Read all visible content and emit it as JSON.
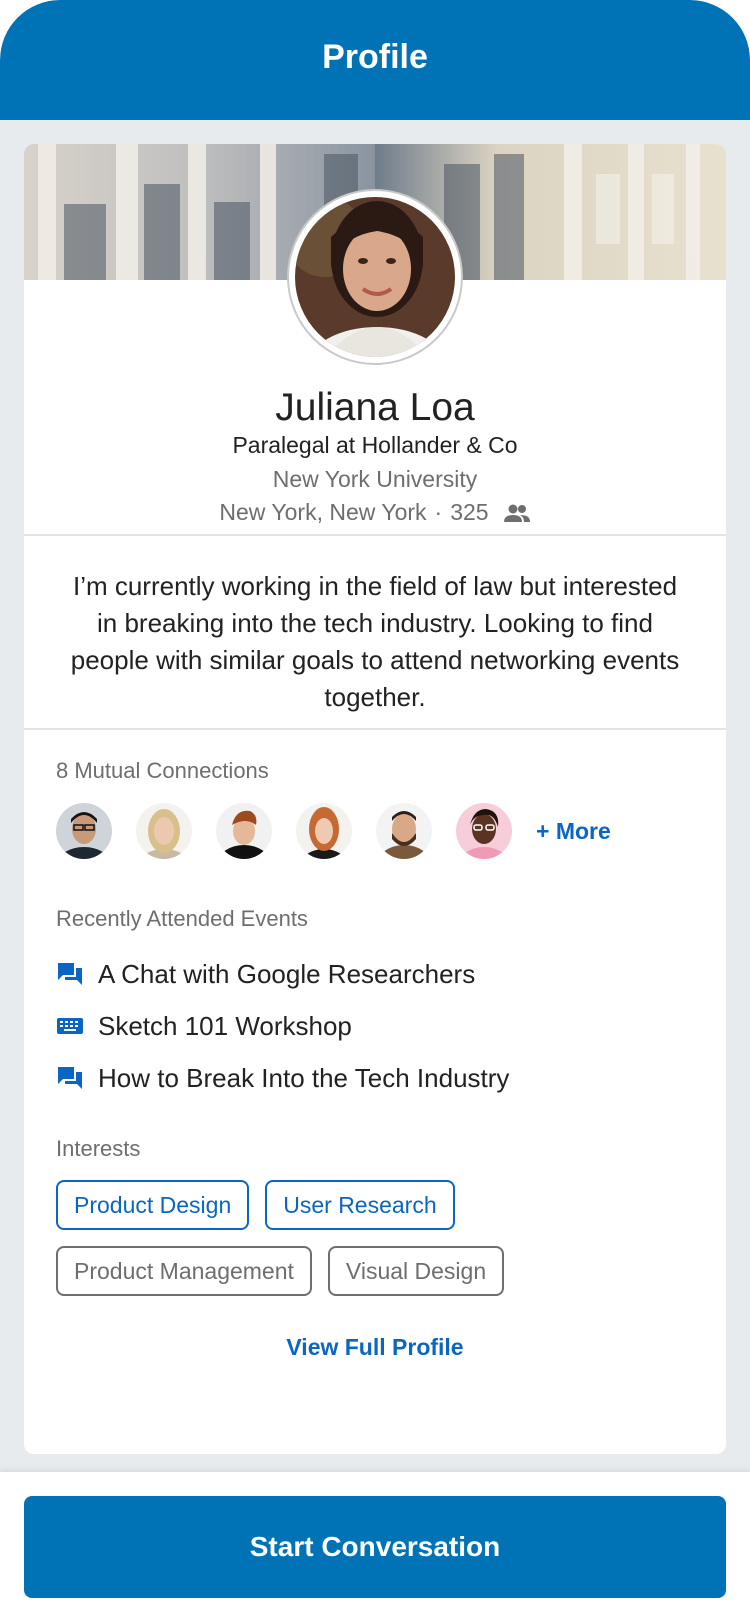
{
  "header": {
    "title": "Profile"
  },
  "profile": {
    "name": "Juliana Loa",
    "headline": "Paralegal at Hollander & Co",
    "school": "New York University",
    "location": "New York, New York",
    "separator": "·",
    "connections_count": "325",
    "bio": "I’m currently working in the field of law but interested in breaking into the tech industry. Looking to find people with similar goals to attend networking events together."
  },
  "mutual": {
    "label": "8 Mutual Connections",
    "more_label": "+ More"
  },
  "events": {
    "label": "Recently Attended Events",
    "items": [
      {
        "icon": "chat-icon",
        "label": "A Chat with Google Researchers"
      },
      {
        "icon": "keyboard-icon",
        "label": "Sketch 101 Workshop"
      },
      {
        "icon": "chat-icon",
        "label": "How to Break Into the Tech Industry"
      }
    ]
  },
  "interests": {
    "label": "Interests",
    "items": [
      {
        "label": "Product Design",
        "active": true
      },
      {
        "label": "User Research",
        "active": true
      },
      {
        "label": "Product Management",
        "active": false
      },
      {
        "label": "Visual Design",
        "active": false
      }
    ]
  },
  "links": {
    "view_full_profile": "View Full Profile"
  },
  "footer": {
    "cta_label": "Start Conversation"
  },
  "colors": {
    "brand_blue": "#0073b6",
    "link_blue": "#0a66c2",
    "muted_text": "#6e6e6e",
    "background": "#e8ebee"
  }
}
